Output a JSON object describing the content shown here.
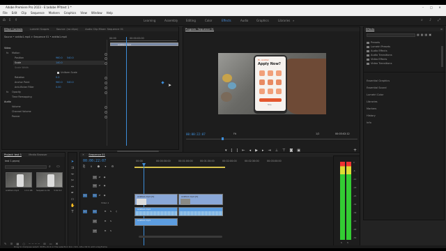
{
  "window": {
    "title": "Adobe Premiere Pro 2023 - E:\\adobe PP\\test 1 *"
  },
  "menu": [
    "File",
    "Edit",
    "Clip",
    "Sequence",
    "Markers",
    "Graphics",
    "View",
    "Window",
    "Help"
  ],
  "workspaces": [
    "Learning",
    "Assembly",
    "Editing",
    "Color",
    "Effects",
    "Audio",
    "Graphics",
    "Libraries"
  ],
  "active_workspace": "Effects",
  "effect_controls": {
    "tabs": [
      "Effect Controls",
      "Lumetri Scopes",
      "Source: (no clips)",
      "Audio Clip Mixer: Sequence 01"
    ],
    "source_line": "Source • ankita1.mp4  >  Sequence 01 • ankita1.mp4",
    "clip_label": "ankita1.mp4",
    "ruler": [
      "00:00",
      "00:00:02:00"
    ],
    "sections": {
      "video": "Video",
      "motion": "Motion",
      "opacity": "Opacity",
      "time_remap": "Time Remapping",
      "audio": "Audio",
      "volume": "Volume",
      "channel_volume": "Channel Volume",
      "panner": "Panner"
    },
    "params": [
      {
        "name": "Position",
        "value": "960.0",
        "value2": "540.0"
      },
      {
        "name": "Scale",
        "value": "140.0"
      },
      {
        "name": "Scale Width",
        "value": "100.0"
      },
      {
        "name": "Uniform Scale",
        "value": "Uniform Scale"
      },
      {
        "name": "Rotation",
        "value": "0.0"
      },
      {
        "name": "Anchor Point",
        "value": "960.0",
        "value2": "540.0"
      },
      {
        "name": "Anti-flicker Filter",
        "value": "0.00"
      }
    ],
    "timecode": "00:00:22:07"
  },
  "program": {
    "title": "Program: Sequence 01",
    "timecode": "00:00:22:07",
    "fit": "Fit",
    "quality": "1/2",
    "duration": "00:03:02:12",
    "phone_text": {
      "line1": "Hi, Ankita!",
      "line2": "Apply Now?",
      "line3": "Skip"
    }
  },
  "effects_panel": {
    "title": "Effects",
    "items": [
      "Presets",
      "Lumetri Presets",
      "Audio Effects",
      "Audio Transitions",
      "Video Effects",
      "Video Transitions"
    ],
    "sections": [
      "Essential Graphics",
      "Essential Sound",
      "Lumetri Color",
      "Libraries",
      "Markers",
      "History",
      "Info"
    ]
  },
  "project": {
    "tabs": [
      "Project: test 1",
      "Media Browser"
    ],
    "name": "test 1.prproj",
    "items": [
      {
        "name": "ankita1.mp4",
        "dur": "1:11:06"
      },
      {
        "name": "Sequence 01",
        "dur": "3:02:12"
      }
    ]
  },
  "timeline": {
    "tab": "Sequence 01",
    "timecode": "00:00:22:07",
    "ruler": [
      "00:00",
      "00:00:30:00",
      "00:01:00:00",
      "00:01:30:00",
      "00:02:00:00",
      "00:02:30:00",
      "00:03:00:00"
    ],
    "tracks": [
      "V3",
      "V2",
      "V1",
      "A1",
      "A2",
      "A3"
    ],
    "track_names": {
      "v1": "Video 1"
    },
    "clip_label": "ankita1.mp4 [V]",
    "clip_label_a": "ankita1.mp4"
  },
  "audio_meter": {
    "scale": [
      "0",
      "-6",
      "-12",
      "-18",
      "-24",
      "-30",
      "-36",
      "-42",
      "-48",
      "-54"
    ],
    "labels": [
      "S",
      "S"
    ]
  },
  "status": "Drag to marquee select. Shift+click or the selection box click, Alt+clik to add a keyframe",
  "colors": {
    "accent": "#4a90e2",
    "video_clip": "#8aa8d8",
    "audio_clip": "#5c9de0",
    "playhead": "#3d8eda"
  }
}
